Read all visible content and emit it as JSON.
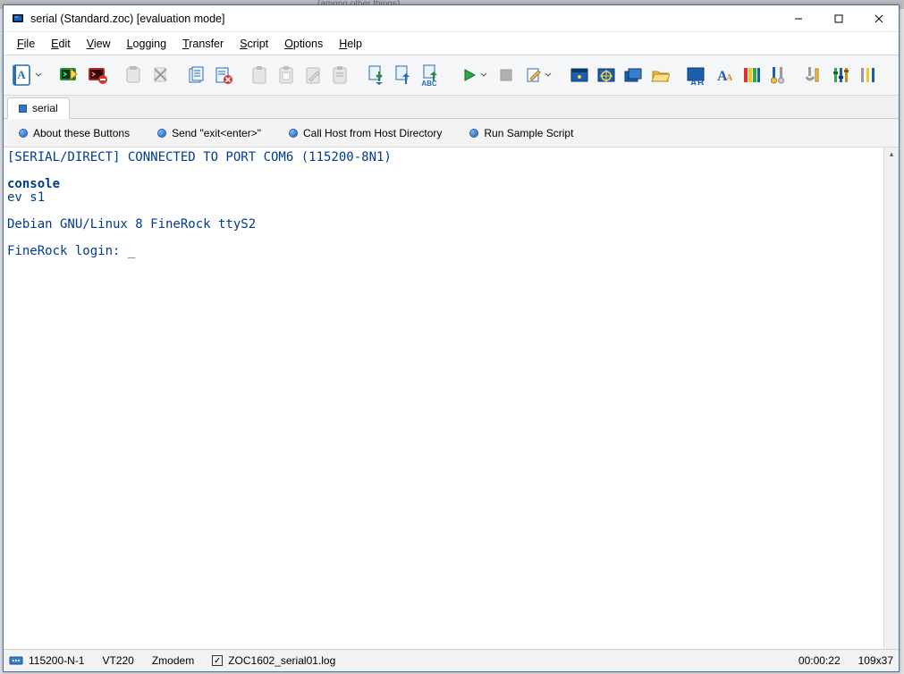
{
  "background": {
    "behind_text": "(among other things)"
  },
  "window": {
    "title": "serial (Standard.zoc) [evaluation mode]"
  },
  "menu": {
    "items": [
      {
        "label": "File",
        "accel": "F"
      },
      {
        "label": "Edit",
        "accel": "E"
      },
      {
        "label": "View",
        "accel": "V"
      },
      {
        "label": "Logging",
        "accel": "L"
      },
      {
        "label": "Transfer",
        "accel": "T"
      },
      {
        "label": "Script",
        "accel": "S"
      },
      {
        "label": "Options",
        "accel": "O"
      },
      {
        "label": "Help",
        "accel": "H"
      }
    ]
  },
  "tabs": {
    "active": {
      "label": "serial"
    }
  },
  "userbuttons": [
    {
      "label": "About these Buttons"
    },
    {
      "label": "Send \"exit<enter>\""
    },
    {
      "label": "Call Host from Host Directory"
    },
    {
      "label": "Run Sample Script"
    }
  ],
  "terminal": {
    "line1": "[SERIAL/DIRECT] CONNECTED TO PORT COM6 (115200-8N1)",
    "line2": "",
    "line3_bold": "console",
    "line4": "ev s1",
    "line5": "",
    "line6": "Debian GNU/Linux 8 FineRock ttyS2",
    "line7": "",
    "line8_prefix": "FineRock login: ",
    "cursor": "_"
  },
  "status": {
    "port": "115200-N-1",
    "emulation": "VT220",
    "protocol": "Zmodem",
    "log_checked": true,
    "log_name": "ZOC1602_serial01.log",
    "time": "00:00:22",
    "size": "109x37"
  },
  "toolbar_icons": {
    "host_dir": "host-directory-icon",
    "quick_conn1": "quick-connect-green-icon",
    "quick_conn2": "quick-connect-red-icon",
    "paste": "paste-icon",
    "paste_x": "cut-disabled-icon",
    "copy1": "copy-page-icon",
    "copy_del": "copy-delete-icon",
    "clip1": "clipboard-1-icon",
    "clip2": "clipboard-2-icon",
    "clip3": "clipboard-edit-icon",
    "clip4": "clipboard-4-icon",
    "download": "download-icon",
    "upload": "upload-icon",
    "upload_abc": "upload-text-icon",
    "play": "play-script-icon",
    "stop": "stop-script-icon",
    "edit_script": "edit-script-icon",
    "win1": "window-blue-icon",
    "win2": "window-target-icon",
    "win3": "window-stack-icon",
    "folder": "open-folder-icon",
    "ab": "text-ab-icon",
    "font": "font-aa-icon",
    "colors": "color-bars-icon",
    "tool1": "tool-1-icon",
    "tool2": "tool-wrench-icon",
    "tool3": "tool-sliders-icon",
    "tool4": "tool-options-icon"
  }
}
